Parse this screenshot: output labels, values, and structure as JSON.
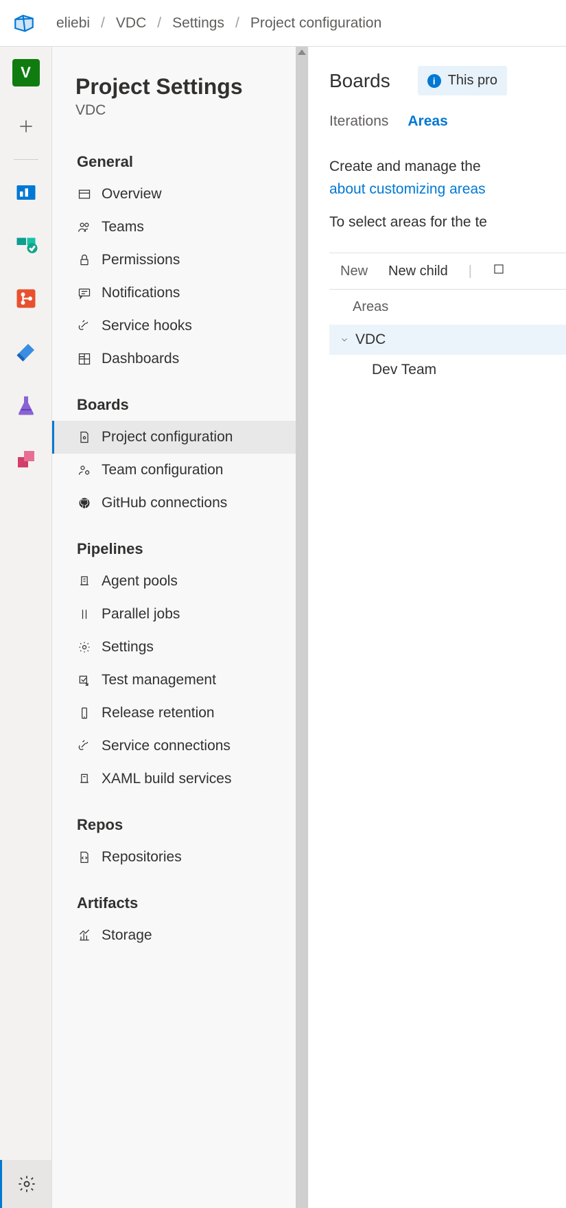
{
  "breadcrumb": {
    "root": "eliebi",
    "project": "VDC",
    "section": "Settings",
    "current": "Project configuration"
  },
  "rail": {
    "project_initial": "V"
  },
  "settings": {
    "title": "Project Settings",
    "subtitle": "VDC",
    "sections": {
      "general": {
        "label": "General",
        "items": {
          "overview": "Overview",
          "teams": "Teams",
          "permissions": "Permissions",
          "notifications": "Notifications",
          "service_hooks": "Service hooks",
          "dashboards": "Dashboards"
        }
      },
      "boards": {
        "label": "Boards",
        "items": {
          "project_configuration": "Project configuration",
          "team_configuration": "Team configuration",
          "github_connections": "GitHub connections"
        }
      },
      "pipelines": {
        "label": "Pipelines",
        "items": {
          "agent_pools": "Agent pools",
          "parallel_jobs": "Parallel jobs",
          "settings": "Settings",
          "test_management": "Test management",
          "release_retention": "Release retention",
          "service_connections": "Service connections",
          "xaml_build_services": "XAML build services"
        }
      },
      "repos": {
        "label": "Repos",
        "items": {
          "repositories": "Repositories"
        }
      },
      "artifacts": {
        "label": "Artifacts",
        "items": {
          "storage": "Storage"
        }
      }
    }
  },
  "content": {
    "title": "Boards",
    "info_text": "This pro",
    "tabs": {
      "iterations": "Iterations",
      "areas": "Areas",
      "active": "areas"
    },
    "desc_line1": "Create and manage the ",
    "desc_link": "about customizing areas",
    "desc_line2": "To select areas for the te",
    "toolbar": {
      "new": "New",
      "new_child": "New child"
    },
    "areas_header": "Areas",
    "tree": {
      "root": "VDC",
      "child": "Dev Team"
    }
  }
}
